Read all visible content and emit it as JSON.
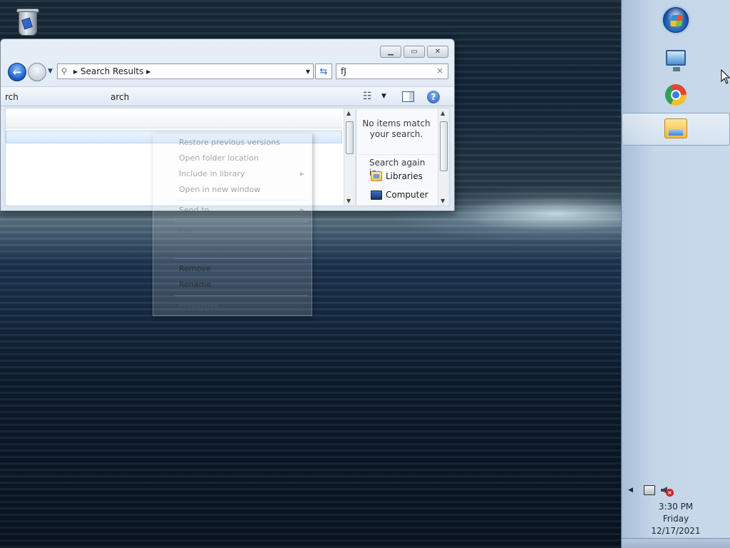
{
  "desktop": {
    "icons": [
      {
        "name": "Recycle Bin",
        "icon": "recycle-bin-icon"
      }
    ]
  },
  "explorer": {
    "address": {
      "breadcrumb": [
        "Search Results"
      ]
    },
    "search": {
      "value": "fJ",
      "clear_glyph": "×"
    },
    "command_bar": {
      "left_text_1": "rch",
      "left_text_2": "arch"
    },
    "side_panel": {
      "no_items": "No items match your search.",
      "search_again_label": "Search again in:",
      "links": [
        "Libraries",
        "Computer"
      ]
    }
  },
  "context_menu": {
    "items": [
      {
        "label": "Restore previous versions",
        "submenu": false
      },
      {
        "label": "Open folder location",
        "submenu": false
      },
      {
        "label": "Include in library",
        "submenu": true
      },
      {
        "label": "Open in new window",
        "submenu": false
      },
      {
        "label": "Send to",
        "submenu": true
      },
      {
        "label": "Cut",
        "submenu": false
      },
      {
        "label": "Copy",
        "submenu": false
      },
      {
        "label": "Remove",
        "submenu": false
      },
      {
        "label": "Rename",
        "submenu": false
      },
      {
        "label": "Properties",
        "submenu": false
      }
    ]
  },
  "taskbar": {
    "start": "start-orb-icon",
    "pinned": [
      "remote-desktop-icon",
      "chrome-icon",
      "windows-explorer-icon"
    ],
    "active_app": "windows-explorer-icon",
    "clock": {
      "time": "3:30 PM",
      "day": "Friday",
      "date": "12/17/2021"
    }
  },
  "colors": {
    "taskbar": "#c4d6e8",
    "window_frame": "#dbe6f2",
    "accent": "#1b5fc9"
  }
}
